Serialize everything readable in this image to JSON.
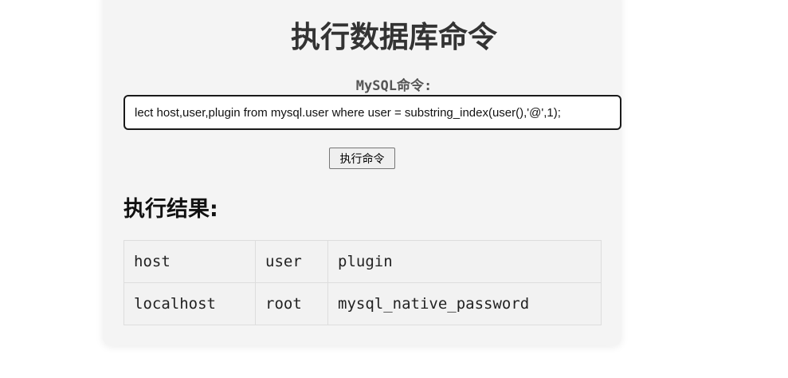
{
  "page": {
    "title": "执行数据库命令",
    "command_label": "MySQL命令:",
    "command_value": "lect host,user,plugin from mysql.user where user = substring_index(user(),'@',1);",
    "execute_button": "执行命令",
    "result_heading": "执行结果:"
  },
  "result_table": {
    "headers": [
      "host",
      "user",
      "plugin"
    ],
    "rows": [
      [
        "localhost",
        "root",
        "mysql_native_password"
      ]
    ]
  }
}
